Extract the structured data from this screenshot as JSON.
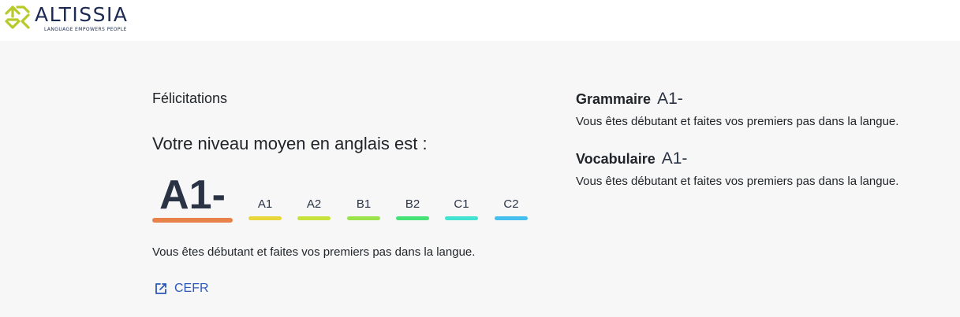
{
  "brand": {
    "name": "ALTISSIA",
    "tagline": "LANGUAGE EMPOWERS PEOPLE",
    "colors": {
      "mark": "#b8c92a",
      "text": "#1b2a52"
    }
  },
  "result": {
    "congrats": "Félicitations",
    "level_title": "Votre niveau moyen en anglais est :",
    "level": "A1-",
    "level_bar_color": "#e8824a",
    "description": "Vous êtes débutant et faites vos premiers pas dans la langue.",
    "scale": [
      {
        "label": "A1",
        "color": "#e9d63a"
      },
      {
        "label": "A2",
        "color": "#c7e23a"
      },
      {
        "label": "B1",
        "color": "#9be34a"
      },
      {
        "label": "B2",
        "color": "#47e276"
      },
      {
        "label": "C1",
        "color": "#43e3d2"
      },
      {
        "label": "C2",
        "color": "#45c0ee"
      }
    ],
    "link": {
      "label": "CEFR",
      "icon": "external-link-icon"
    }
  },
  "skills": [
    {
      "name": "Grammaire",
      "level": "A1-",
      "description": "Vous êtes débutant et faites vos premiers pas dans la langue."
    },
    {
      "name": "Vocabulaire",
      "level": "A1-",
      "description": "Vous êtes débutant et faites vos premiers pas dans la langue."
    }
  ]
}
